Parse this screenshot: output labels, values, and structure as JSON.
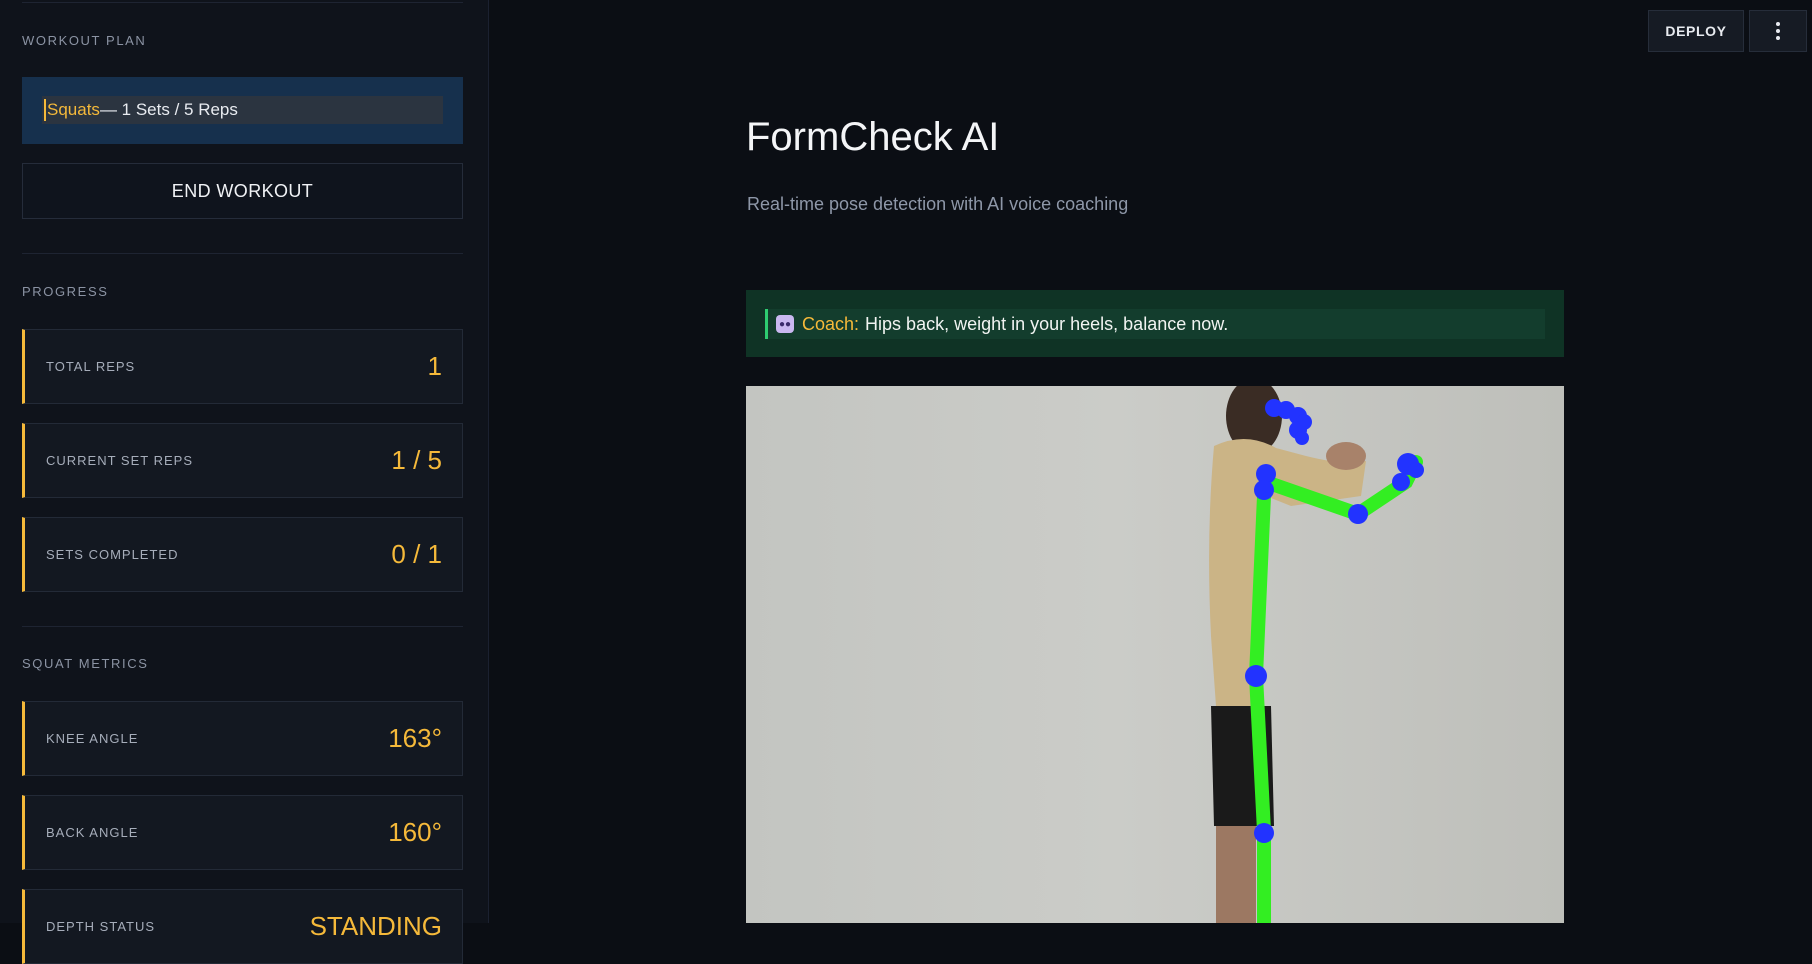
{
  "sidebar": {
    "workout_plan_label": "WORKOUT PLAN",
    "plan": {
      "exercise": "Squats",
      "details": " — 1 Sets / 5 Reps"
    },
    "end_button": "END WORKOUT",
    "progress_label": "PROGRESS",
    "progress": [
      {
        "label": "TOTAL REPS",
        "value": "1"
      },
      {
        "label": "CURRENT SET REPS",
        "value": "1 / 5"
      },
      {
        "label": "SETS COMPLETED",
        "value": "0 / 1"
      }
    ],
    "metrics_label": "SQUAT METRICS",
    "metrics": [
      {
        "label": "KNEE ANGLE",
        "value": "163°"
      },
      {
        "label": "BACK ANGLE",
        "value": "160°"
      },
      {
        "label": "DEPTH STATUS",
        "value": "STANDING"
      }
    ]
  },
  "toolbar": {
    "deploy": "DEPLOY"
  },
  "main": {
    "title": "FormCheck AI",
    "subtitle": "Real-time pose detection with AI voice coaching",
    "coach": {
      "name": "Coach:",
      "message": "Hips back, weight in your heels, balance now."
    }
  },
  "colors": {
    "accent": "#f5b93a",
    "skeleton_line": "#33ee22",
    "skeleton_joint": "#2233ff",
    "coach_border": "#2ecc71"
  },
  "icons": {
    "coach": "robot-icon",
    "menu": "vertical-dots-icon"
  }
}
